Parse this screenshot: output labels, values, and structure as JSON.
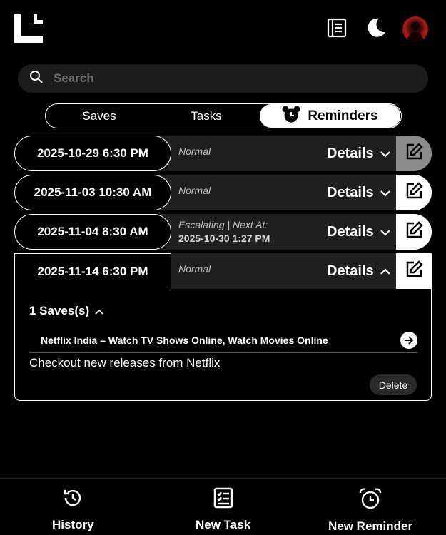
{
  "header": {
    "logo_icon": "app-logo",
    "notebook_icon": "notebook-icon",
    "theme_icon": "moon-icon",
    "avatar": "user-avatar"
  },
  "search": {
    "placeholder": "Search"
  },
  "tabs": [
    {
      "label": "Saves",
      "active": false
    },
    {
      "label": "Tasks",
      "active": false
    },
    {
      "label": "Reminders",
      "active": true,
      "icon": "alarm-clock-icon"
    }
  ],
  "reminders": [
    {
      "date": "2025-10-29 6:30 PM",
      "status": "Normal",
      "details_label": "Details",
      "expanded": false
    },
    {
      "date": "2025-11-03 10:30 AM",
      "status": "Normal",
      "details_label": "Details",
      "expanded": false
    },
    {
      "date": "2025-11-04 8:30 AM",
      "status_line1": "Escalating | Next At:",
      "status_line2": "2025-10-30 1:27 PM",
      "details_label": "Details",
      "expanded": false
    },
    {
      "date": "2025-11-14 6:30 PM",
      "status": "Normal",
      "details_label": "Details",
      "expanded": true
    }
  ],
  "expanded_panel": {
    "saves_count_label": "1 Saves(s)",
    "save_item_title": "Netflix India – Watch TV Shows Online, Watch Movies Online",
    "note": "Checkout new releases from Netflix",
    "delete_label": "Delete"
  },
  "bottom_nav": [
    {
      "label": "History",
      "icon": "history-icon"
    },
    {
      "label": "New Task",
      "icon": "task-list-icon"
    },
    {
      "label": "New Reminder",
      "icon": "alarm-clock-icon"
    }
  ],
  "colors": {
    "background": "#000000",
    "surface": "#1f1f1f",
    "edit_disabled": "#8c8c8c",
    "text": "#ffffff"
  }
}
